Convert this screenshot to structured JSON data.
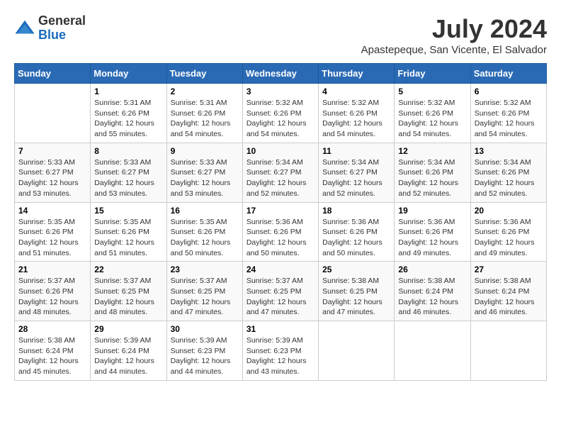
{
  "header": {
    "logo_general": "General",
    "logo_blue": "Blue",
    "month_year": "July 2024",
    "location": "Apastepeque, San Vicente, El Salvador"
  },
  "weekdays": [
    "Sunday",
    "Monday",
    "Tuesday",
    "Wednesday",
    "Thursday",
    "Friday",
    "Saturday"
  ],
  "weeks": [
    [
      {
        "day": "",
        "info": ""
      },
      {
        "day": "1",
        "info": "Sunrise: 5:31 AM\nSunset: 6:26 PM\nDaylight: 12 hours\nand 55 minutes."
      },
      {
        "day": "2",
        "info": "Sunrise: 5:31 AM\nSunset: 6:26 PM\nDaylight: 12 hours\nand 54 minutes."
      },
      {
        "day": "3",
        "info": "Sunrise: 5:32 AM\nSunset: 6:26 PM\nDaylight: 12 hours\nand 54 minutes."
      },
      {
        "day": "4",
        "info": "Sunrise: 5:32 AM\nSunset: 6:26 PM\nDaylight: 12 hours\nand 54 minutes."
      },
      {
        "day": "5",
        "info": "Sunrise: 5:32 AM\nSunset: 6:26 PM\nDaylight: 12 hours\nand 54 minutes."
      },
      {
        "day": "6",
        "info": "Sunrise: 5:32 AM\nSunset: 6:26 PM\nDaylight: 12 hours\nand 54 minutes."
      }
    ],
    [
      {
        "day": "7",
        "info": "Sunrise: 5:33 AM\nSunset: 6:27 PM\nDaylight: 12 hours\nand 53 minutes."
      },
      {
        "day": "8",
        "info": "Sunrise: 5:33 AM\nSunset: 6:27 PM\nDaylight: 12 hours\nand 53 minutes."
      },
      {
        "day": "9",
        "info": "Sunrise: 5:33 AM\nSunset: 6:27 PM\nDaylight: 12 hours\nand 53 minutes."
      },
      {
        "day": "10",
        "info": "Sunrise: 5:34 AM\nSunset: 6:27 PM\nDaylight: 12 hours\nand 52 minutes."
      },
      {
        "day": "11",
        "info": "Sunrise: 5:34 AM\nSunset: 6:27 PM\nDaylight: 12 hours\nand 52 minutes."
      },
      {
        "day": "12",
        "info": "Sunrise: 5:34 AM\nSunset: 6:26 PM\nDaylight: 12 hours\nand 52 minutes."
      },
      {
        "day": "13",
        "info": "Sunrise: 5:34 AM\nSunset: 6:26 PM\nDaylight: 12 hours\nand 52 minutes."
      }
    ],
    [
      {
        "day": "14",
        "info": "Sunrise: 5:35 AM\nSunset: 6:26 PM\nDaylight: 12 hours\nand 51 minutes."
      },
      {
        "day": "15",
        "info": "Sunrise: 5:35 AM\nSunset: 6:26 PM\nDaylight: 12 hours\nand 51 minutes."
      },
      {
        "day": "16",
        "info": "Sunrise: 5:35 AM\nSunset: 6:26 PM\nDaylight: 12 hours\nand 50 minutes."
      },
      {
        "day": "17",
        "info": "Sunrise: 5:36 AM\nSunset: 6:26 PM\nDaylight: 12 hours\nand 50 minutes."
      },
      {
        "day": "18",
        "info": "Sunrise: 5:36 AM\nSunset: 6:26 PM\nDaylight: 12 hours\nand 50 minutes."
      },
      {
        "day": "19",
        "info": "Sunrise: 5:36 AM\nSunset: 6:26 PM\nDaylight: 12 hours\nand 49 minutes."
      },
      {
        "day": "20",
        "info": "Sunrise: 5:36 AM\nSunset: 6:26 PM\nDaylight: 12 hours\nand 49 minutes."
      }
    ],
    [
      {
        "day": "21",
        "info": "Sunrise: 5:37 AM\nSunset: 6:26 PM\nDaylight: 12 hours\nand 48 minutes."
      },
      {
        "day": "22",
        "info": "Sunrise: 5:37 AM\nSunset: 6:25 PM\nDaylight: 12 hours\nand 48 minutes."
      },
      {
        "day": "23",
        "info": "Sunrise: 5:37 AM\nSunset: 6:25 PM\nDaylight: 12 hours\nand 47 minutes."
      },
      {
        "day": "24",
        "info": "Sunrise: 5:37 AM\nSunset: 6:25 PM\nDaylight: 12 hours\nand 47 minutes."
      },
      {
        "day": "25",
        "info": "Sunrise: 5:38 AM\nSunset: 6:25 PM\nDaylight: 12 hours\nand 47 minutes."
      },
      {
        "day": "26",
        "info": "Sunrise: 5:38 AM\nSunset: 6:24 PM\nDaylight: 12 hours\nand 46 minutes."
      },
      {
        "day": "27",
        "info": "Sunrise: 5:38 AM\nSunset: 6:24 PM\nDaylight: 12 hours\nand 46 minutes."
      }
    ],
    [
      {
        "day": "28",
        "info": "Sunrise: 5:38 AM\nSunset: 6:24 PM\nDaylight: 12 hours\nand 45 minutes."
      },
      {
        "day": "29",
        "info": "Sunrise: 5:39 AM\nSunset: 6:24 PM\nDaylight: 12 hours\nand 44 minutes."
      },
      {
        "day": "30",
        "info": "Sunrise: 5:39 AM\nSunset: 6:23 PM\nDaylight: 12 hours\nand 44 minutes."
      },
      {
        "day": "31",
        "info": "Sunrise: 5:39 AM\nSunset: 6:23 PM\nDaylight: 12 hours\nand 43 minutes."
      },
      {
        "day": "",
        "info": ""
      },
      {
        "day": "",
        "info": ""
      },
      {
        "day": "",
        "info": ""
      }
    ]
  ]
}
